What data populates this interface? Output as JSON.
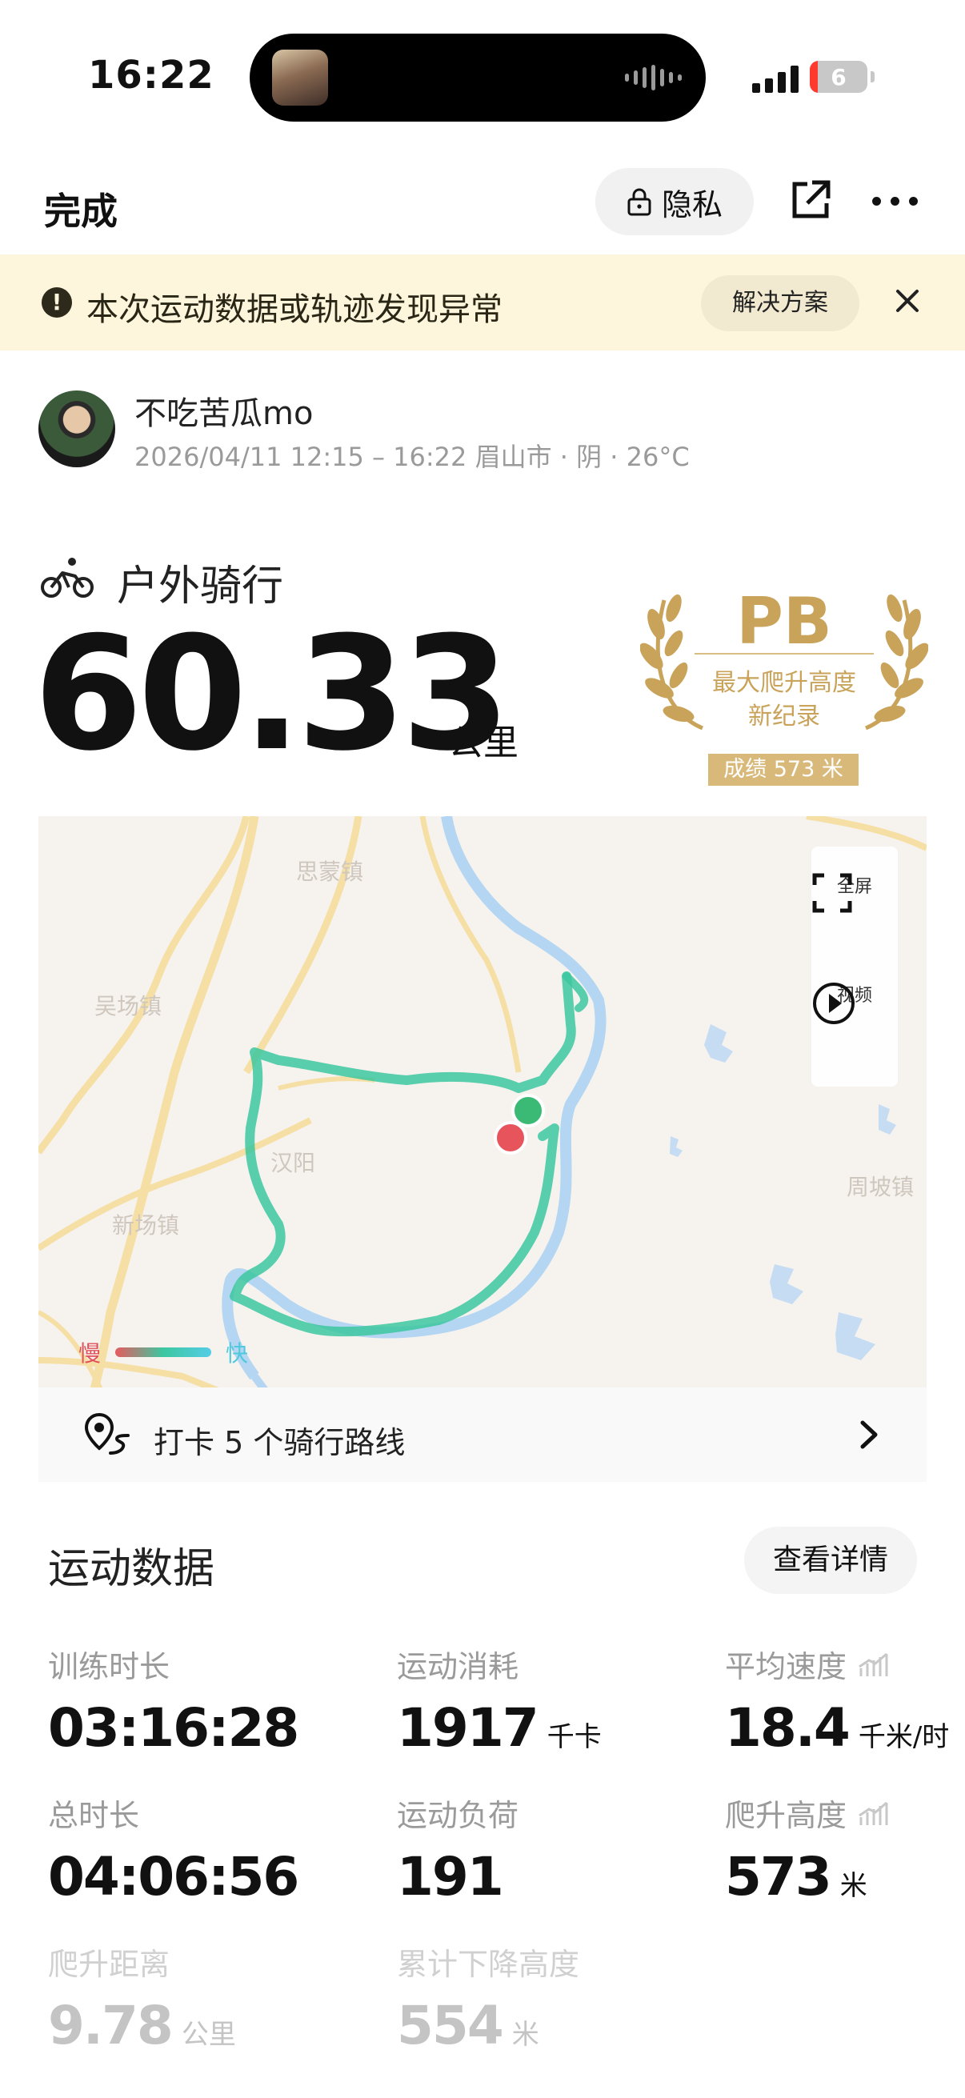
{
  "status_bar": {
    "time": "16:22",
    "battery": "6"
  },
  "nav": {
    "done_label": "完成",
    "privacy_label": "隐私"
  },
  "alert": {
    "message": "本次运动数据或轨迹发现异常",
    "action_label": "解决方案"
  },
  "user": {
    "name": "不吃苦瓜mo",
    "meta": "2026/04/11 12:15 – 16:22  眉山市 · 阴 · 26°C"
  },
  "activity": {
    "type": "户外骑行",
    "distance": "60.33",
    "distance_unit": "公里"
  },
  "pb_badge": {
    "title": "PB",
    "line1": "最大爬升高度",
    "line2": "新纪录",
    "result": "成绩 573 米",
    "color": "#c9a35a"
  },
  "map": {
    "labels": [
      "思蒙镇",
      "吴场镇",
      "新场镇",
      "周坡镇",
      "汉阳"
    ],
    "fullscreen_label": "全屏",
    "video_label": "视频",
    "legend_slow": "慢",
    "legend_fast": "快",
    "track_color": "#3cc7a0",
    "start_color": "#3aba74",
    "end_color": "#e8545c"
  },
  "checkin": {
    "text": "打卡 5 个骑行路线"
  },
  "stats_section": {
    "title": "运动数据",
    "detail_label": "查看详情",
    "items": [
      {
        "label": "训练时长",
        "value": "03:16:28",
        "unit": ""
      },
      {
        "label": "运动消耗",
        "value": "1917",
        "unit": "千卡"
      },
      {
        "label": "平均速度",
        "value": "18.4",
        "unit": "千米/时"
      },
      {
        "label": "总时长",
        "value": "04:06:56",
        "unit": ""
      },
      {
        "label": "运动负荷",
        "value": "191",
        "unit": ""
      },
      {
        "label": "爬升高度",
        "value": "573",
        "unit": "米"
      },
      {
        "label": "爬升距离",
        "value": "9.78",
        "unit": "公里"
      },
      {
        "label": "累计下降高度",
        "value": "554",
        "unit": "米"
      }
    ]
  }
}
